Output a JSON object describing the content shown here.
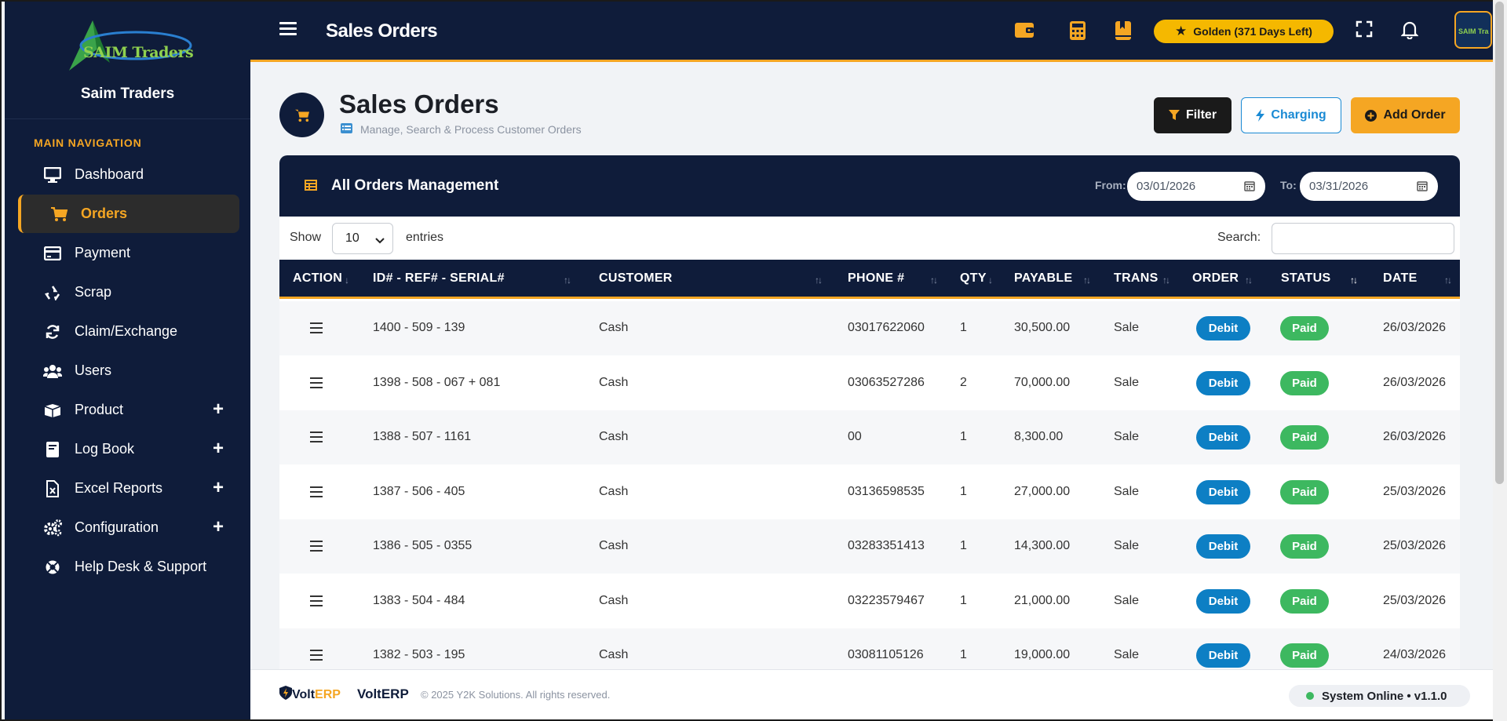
{
  "sidebar": {
    "logo_text": "SAIM Traders",
    "brand_name": "Saim Traders",
    "nav_heading": "MAIN NAVIGATION",
    "items": [
      {
        "label": "Dashboard",
        "icon": "monitor-icon",
        "active": false,
        "expandable": false
      },
      {
        "label": "Orders",
        "icon": "cart-icon",
        "active": true,
        "expandable": false
      },
      {
        "label": "Payment",
        "icon": "credit-card-icon",
        "active": false,
        "expandable": false
      },
      {
        "label": "Scrap",
        "icon": "recycle-icon",
        "active": false,
        "expandable": false
      },
      {
        "label": "Claim/Exchange",
        "icon": "refresh-icon",
        "active": false,
        "expandable": false
      },
      {
        "label": "Users",
        "icon": "users-icon",
        "active": false,
        "expandable": false
      },
      {
        "label": "Product",
        "icon": "box-icon",
        "active": false,
        "expandable": true
      },
      {
        "label": "Log Book",
        "icon": "book-icon",
        "active": false,
        "expandable": true
      },
      {
        "label": "Excel Reports",
        "icon": "excel-file-icon",
        "active": false,
        "expandable": true
      },
      {
        "label": "Configuration",
        "icon": "cogs-icon",
        "active": false,
        "expandable": true
      },
      {
        "label": "Help Desk & Support",
        "icon": "lifebuoy-icon",
        "active": false,
        "expandable": false
      }
    ]
  },
  "topbar": {
    "title": "Sales Orders",
    "plan_badge": "Golden (371 Days Left)",
    "avatar_text": "SAIM Tra"
  },
  "page": {
    "title": "Sales Orders",
    "subtitle": "Manage, Search & Process Customer Orders",
    "buttons": {
      "filter": "Filter",
      "charging": "Charging",
      "add_order": "Add Order"
    }
  },
  "card": {
    "title": "All Orders Management",
    "from_label": "From:",
    "from_value": "03/01/2026",
    "to_label": "To:",
    "to_value": "03/31/2026",
    "show_label": "Show",
    "entries_value": "10",
    "entries_label": "entries",
    "search_label": "Search:",
    "search_value": ""
  },
  "table": {
    "headers": [
      "ACTION",
      "ID# - REF# - SERIAL#",
      "CUSTOMER",
      "PHONE #",
      "QTY",
      "PAYABLE",
      "TRANS",
      "ORDER",
      "STATUS",
      "DATE"
    ],
    "rows": [
      {
        "id": "1400 - 509 - 139",
        "customer": "Cash",
        "phone": "03017622060",
        "qty": "1",
        "payable": "30,500.00",
        "trans": "Sale",
        "order": "Debit",
        "status": "Paid",
        "date": "26/03/2026"
      },
      {
        "id": "1398 - 508 - 067 + 081",
        "customer": "Cash",
        "phone": "03063527286",
        "qty": "2",
        "payable": "70,000.00",
        "trans": "Sale",
        "order": "Debit",
        "status": "Paid",
        "date": "26/03/2026"
      },
      {
        "id": "1388 - 507 - 1161",
        "customer": "Cash",
        "phone": "00",
        "qty": "1",
        "payable": "8,300.00",
        "trans": "Sale",
        "order": "Debit",
        "status": "Paid",
        "date": "26/03/2026"
      },
      {
        "id": "1387 - 506 - 405",
        "customer": "Cash",
        "phone": "03136598535",
        "qty": "1",
        "payable": "27,000.00",
        "trans": "Sale",
        "order": "Debit",
        "status": "Paid",
        "date": "25/03/2026"
      },
      {
        "id": "1386 - 505 - 0355",
        "customer": "Cash",
        "phone": "03283351413",
        "qty": "1",
        "payable": "14,300.00",
        "trans": "Sale",
        "order": "Debit",
        "status": "Paid",
        "date": "25/03/2026"
      },
      {
        "id": "1383 - 504 - 484",
        "customer": "Cash",
        "phone": "03223579467",
        "qty": "1",
        "payable": "21,000.00",
        "trans": "Sale",
        "order": "Debit",
        "status": "Paid",
        "date": "25/03/2026"
      },
      {
        "id": "1382 - 503 - 195",
        "customer": "Cash",
        "phone": "03081105126",
        "qty": "1",
        "payable": "19,000.00",
        "trans": "Sale",
        "order": "Debit",
        "status": "Paid",
        "date": "24/03/2026"
      }
    ]
  },
  "footer": {
    "logo_volt": "Volt",
    "logo_erp": "ERP",
    "brand": "VoltERP",
    "copyright": "© 2025 Y2K Solutions. All rights reserved.",
    "status": "System Online • v1.1.0"
  },
  "colors": {
    "navy": "#0f1c3a",
    "accent": "#f5a623",
    "debit": "#0d7fc4",
    "paid": "#3db860"
  }
}
